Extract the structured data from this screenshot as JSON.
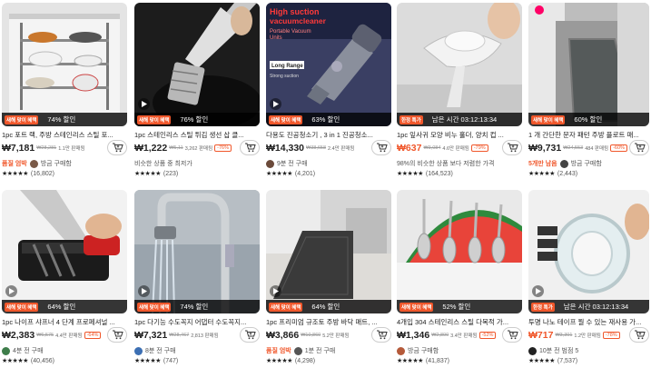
{
  "colors": {
    "accent": "#f0572b",
    "badge_bg": "#222222"
  },
  "products": [
    {
      "badge_pill": "새해 맞이 혜택",
      "badge_text": "74% 할인",
      "title": "1pc 포트 랙, 주방 스테인리스 스틸 포...",
      "price": "₩7,181",
      "price_hot": false,
      "orig": "₩28,281",
      "sold": "1.1만 판매됨",
      "disc": "",
      "meta_em": "품질 엄박",
      "meta_text": "방금 구매함",
      "rating": "(16,802)"
    },
    {
      "badge_pill": "새해 맞이 혜택",
      "badge_text": "76% 할인",
      "title": "1pc 스테인리스 스틸 튀김 생선 삽 클...",
      "price": "₩1,222",
      "price_hot": false,
      "orig": "₩5,11",
      "sold": "3,262 판매됨",
      "disc": "-76%",
      "meta_em": "",
      "meta_text": "비슷한 상품 중 최저가",
      "rating": "(223)"
    },
    {
      "badge_pill": "새해 맞이 혜택",
      "badge_text": "63% 할인",
      "title": "다용도 진공청소기 , 3 in 1 진공청소...",
      "price": "₩14,330",
      "price_hot": false,
      "orig": "₩38,658",
      "sold": "2.4만 판매됨",
      "disc": "",
      "meta_em": "",
      "meta_text": "9분 전 구매",
      "rating": "(4,201)"
    },
    {
      "badge_pill": "한정 특가",
      "badge_text": "남은 시간 03:12:13:34",
      "title": "1pc 잎사귀 모양 비누 홀더, 양치 컵 ...",
      "price": "₩637",
      "price_hot": true,
      "orig": "₩3,084",
      "sold": "4.6만 판매됨",
      "disc": "-79%",
      "meta_em": "",
      "meta_text": "98%의 비슷한 상품 보다 저렴한 가격",
      "rating": "(164,523)"
    },
    {
      "badge_pill": "새해 맞이 혜택",
      "badge_text": "60% 할인",
      "title": "1 개 간단한 문자 패턴 주방 플로트 매...",
      "price": "₩9,731",
      "price_hot": false,
      "orig": "₩24,553",
      "sold": "484 판매됨",
      "disc": "-60%",
      "meta_em": "5개만 남음",
      "meta_text": "방금 구매함",
      "rating": "(2,443)"
    },
    {
      "badge_pill": "새해 맞이 혜택",
      "badge_text": "64% 할인",
      "title": "1pc 나이프 샤프너 4 단계 프로페셔널 ...",
      "price": "₩2,383",
      "price_hot": false,
      "orig": "₩6,575",
      "sold": "4.4만 판매됨",
      "disc": "-64%",
      "meta_em": "",
      "meta_text": "4분 전 구매",
      "rating": "(40,456)"
    },
    {
      "badge_pill": "새해 맞이 혜택",
      "badge_text": "74% 할인",
      "title": "1pc 다기능 수도꼭지 어댑터 수도꼭지...",
      "price": "₩7,321",
      "price_hot": false,
      "orig": "₩28,467",
      "sold": "2,813 판매됨",
      "disc": "",
      "meta_em": "",
      "meta_text": "8분 전 구매",
      "rating": "(747)"
    },
    {
      "badge_pill": "새해 맞이 혜택",
      "badge_text": "64% 할인",
      "title": "1pc 프리미엄 규조토 주방 바닥 매트, ...",
      "price": "₩3,866",
      "price_hot": false,
      "orig": "₩10,860",
      "sold": "5.2만 판매됨",
      "disc": "",
      "meta_em": "품질 엄박",
      "meta_text": "1분 전 구매",
      "rating": "(4,298)"
    },
    {
      "badge_pill": "새해 맞이 혜택",
      "badge_text": "52% 할인",
      "title": "4개입 304 스테인리스 스틸 다목적 가...",
      "price": "₩1,346",
      "price_hot": false,
      "orig": "₩2,800",
      "sold": "3.4만 판매됨",
      "disc": "-52%",
      "meta_em": "",
      "meta_text": "방금 구매함",
      "rating": "(41,837)"
    },
    {
      "badge_pill": "한정 특가",
      "badge_text": "남은 시간 03:12:13:34",
      "title": "투명 나노 테이프 뭘 수 있는 재사용 가...",
      "price": "₩717",
      "price_hot": true,
      "orig": "₩3,301",
      "sold": "1.2만 판매됨",
      "disc": "-78%",
      "meta_em": "",
      "meta_text": "10분 전 범점 5",
      "rating": "(7,537)"
    }
  ],
  "image_captions": {
    "vacuum_line1": "High suction",
    "vacuum_line2": "vacuumcleaner",
    "vacuum_line3": "Portable Vacuum",
    "vacuum_line4": "Units",
    "vacuum_line5": "Long Range",
    "vacuum_line6": "Strong suction"
  }
}
